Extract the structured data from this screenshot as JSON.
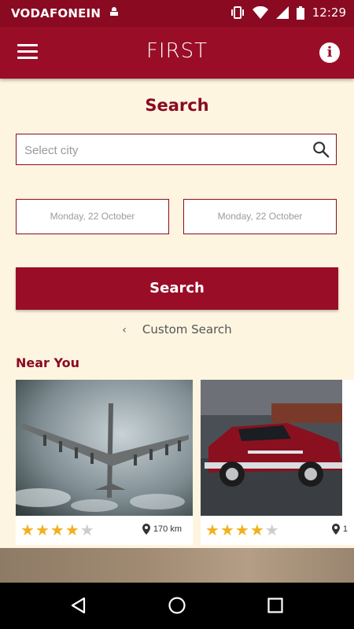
{
  "status": {
    "carrier": "VODAFONEIN",
    "time": "12:29"
  },
  "appbar": {
    "title": "FIRST"
  },
  "search": {
    "heading": "Search",
    "city_placeholder": "Select city",
    "checkin": "Monday, 22 October",
    "checkout": "Monday, 22 October",
    "button": "Search",
    "custom_search": "Custom Search"
  },
  "near": {
    "title": "Near You",
    "cards": [
      {
        "rating": 4,
        "max": 5,
        "distance": "170 km"
      },
      {
        "rating": 4,
        "max": 5,
        "distance": "1"
      }
    ]
  },
  "colors": {
    "primary": "#9a0d27",
    "background": "#fdf5e0",
    "star": "#f2b01e"
  },
  "icons": [
    "menu-icon",
    "info-icon",
    "search-icon",
    "location-pin-icon",
    "back-icon",
    "home-icon",
    "recents-icon"
  ]
}
